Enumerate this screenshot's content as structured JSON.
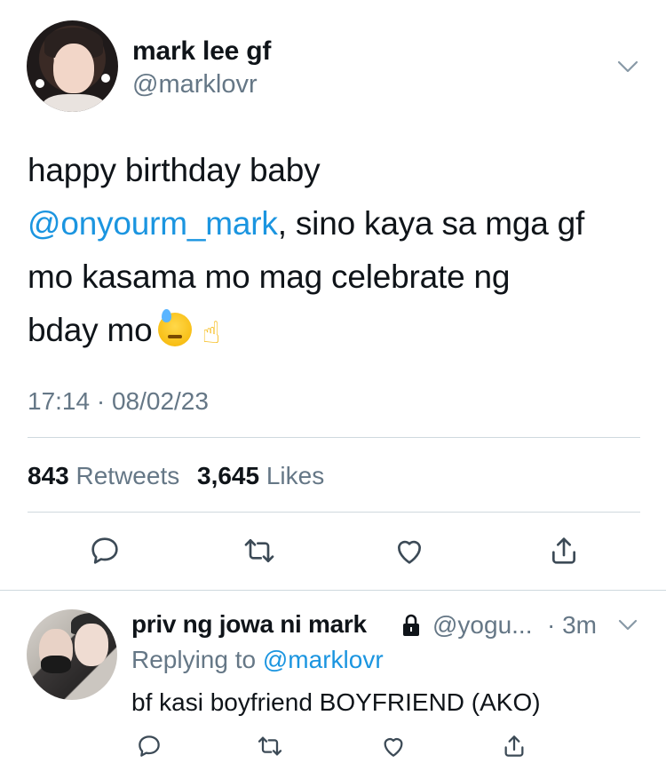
{
  "tweet": {
    "author_name": "mark lee gf",
    "author_handle": "@marklovr",
    "text_line1": "happy birthday baby",
    "mention": "@onyourm_mark",
    "text_line2_rest": ", sino kaya sa mga gf",
    "text_line3": "mo kasama mo mag celebrate ng",
    "text_line4": "bday mo",
    "emoji_1": "sweat-face-emoji",
    "emoji_2": "pointing-up-emoji",
    "timestamp": "17:14 · 08/02/23",
    "retweets_count": "843",
    "retweets_label": "Retweets",
    "likes_count": "3,645",
    "likes_label": "Likes",
    "actions": [
      "reply-icon",
      "retweet-icon",
      "like-icon",
      "share-icon"
    ]
  },
  "reply": {
    "author_name": "priv ng jowa ni mark",
    "locked_icon": "lock-icon",
    "author_handle": "@yogu...",
    "time": "· 3m",
    "replying_prefix": "Replying to",
    "replying_to": "@marklovr",
    "text": "bf kasi boyfriend BOYFRIEND (AKO)",
    "actions": [
      "reply-icon",
      "retweet-icon",
      "like-icon",
      "share-icon"
    ]
  },
  "colors": {
    "text": "#0f1419",
    "muted": "#657786",
    "link": "#1b95e0",
    "divider": "#cfd9de"
  }
}
